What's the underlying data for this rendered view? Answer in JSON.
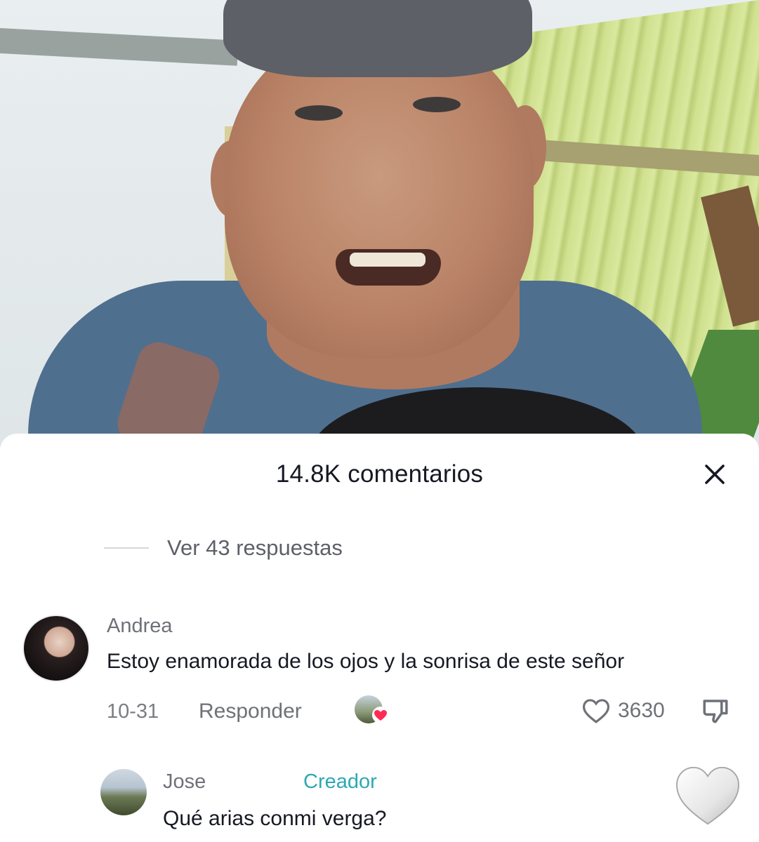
{
  "sheet": {
    "title": "14.8K comentarios",
    "close_icon": "close-icon"
  },
  "thread": {
    "view_replies_label": "Ver 43 respuestas"
  },
  "comments": [
    {
      "author": "Andrea",
      "text": "Estoy enamorada de los ojos y la sonrisa de este señor",
      "date": "10-31",
      "reply_label": "Responder",
      "likes": "3630",
      "liked_by_creator": true
    },
    {
      "author": "Jose",
      "badge": "Creador",
      "text": "Qué arias conmi verga?"
    }
  ],
  "colors": {
    "primary_text": "#161823",
    "secondary_text": "#6f7178",
    "creator_badge": "#2ea8b5",
    "heart_red": "#fe2c55"
  }
}
